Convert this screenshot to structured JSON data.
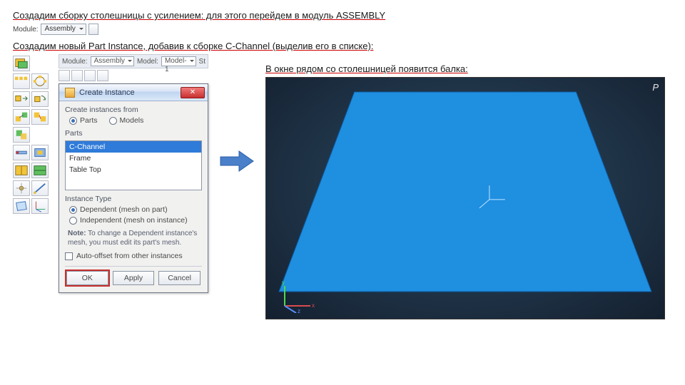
{
  "text": {
    "line1": "Создадим сборку столешницы с усилением: для этого перейдем в модуль ASSEMBLY",
    "line2": "Создадим новый Part Instance, добавив к сборке C-Channel (выделив его в списке):",
    "viewport_caption": "В окне рядом со столешницей появится балка:"
  },
  "module_bar": {
    "module_label": "Module:",
    "module_value": "Assembly"
  },
  "context_bar": {
    "module_label": "Module:",
    "module_value": "Assembly",
    "model_label": "Model:",
    "model_value": "Model-1",
    "step_label": "St"
  },
  "dialog": {
    "title": "Create Instance",
    "create_from_label": "Create instances from",
    "from_parts": "Parts",
    "from_models": "Models",
    "parts_label": "Parts",
    "parts_list": [
      "C-Channel",
      "Frame",
      "Table Top"
    ],
    "instance_type_label": "Instance Type",
    "dep_label": "Dependent (mesh on part)",
    "indep_label": "Independent (mesh on instance)",
    "note_label": "Note:",
    "note_text": "To change a Dependent instance's mesh, you must edit its part's mesh.",
    "auto_offset": "Auto-offset from other instances",
    "ok": "OK",
    "apply": "Apply",
    "cancel": "Cancel"
  },
  "viewport": {
    "corner_badge": "P"
  },
  "colors": {
    "plate_fill": "#1f8fe0",
    "arrow_fill": "#4a7fc9"
  }
}
